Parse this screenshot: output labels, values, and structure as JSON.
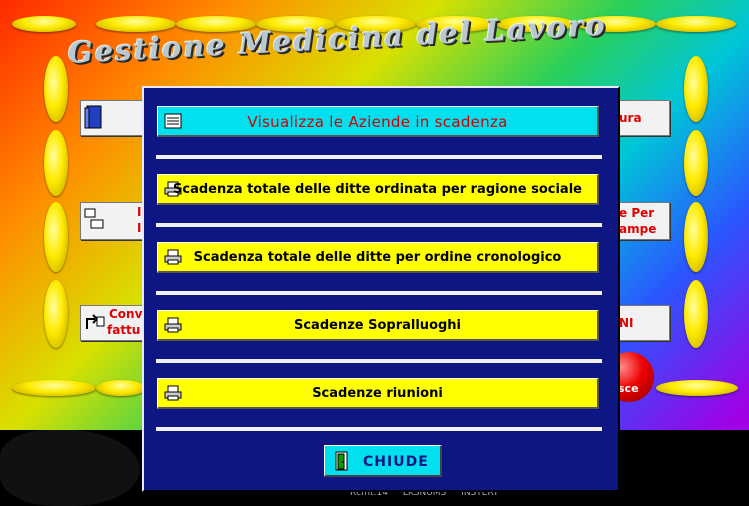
{
  "app": {
    "title": "Gestione Medicina del Lavoro"
  },
  "background_buttons": {
    "top_right": "ura",
    "mid_left_1": "I",
    "mid_left_2": "I",
    "mid_right_1": "e Per",
    "mid_right_2": "ampe",
    "bottom_left_1": "Conv",
    "bottom_left_2": "fattu",
    "bottom_right": "NI",
    "red_ball": "sce"
  },
  "status_bar": [
    "Rcmt:14",
    "LKSNUMS",
    "INSTERT"
  ],
  "dialog": {
    "header_button": "Visualizza le Aziende in scadenza",
    "buttons": [
      "Scadenza totale delle ditte ordinata per ragione sociale",
      "Scadenza totale delle ditte per ordine cronologico",
      "Scadenze Sopralluoghi",
      "Scadenze riunioni"
    ],
    "close_button": "CHIUDE"
  },
  "colors": {
    "dialog_bg": "#0d1682",
    "button_yellow": "#ffff00",
    "button_cyan": "#00e0ee",
    "label_red": "#d00000"
  }
}
